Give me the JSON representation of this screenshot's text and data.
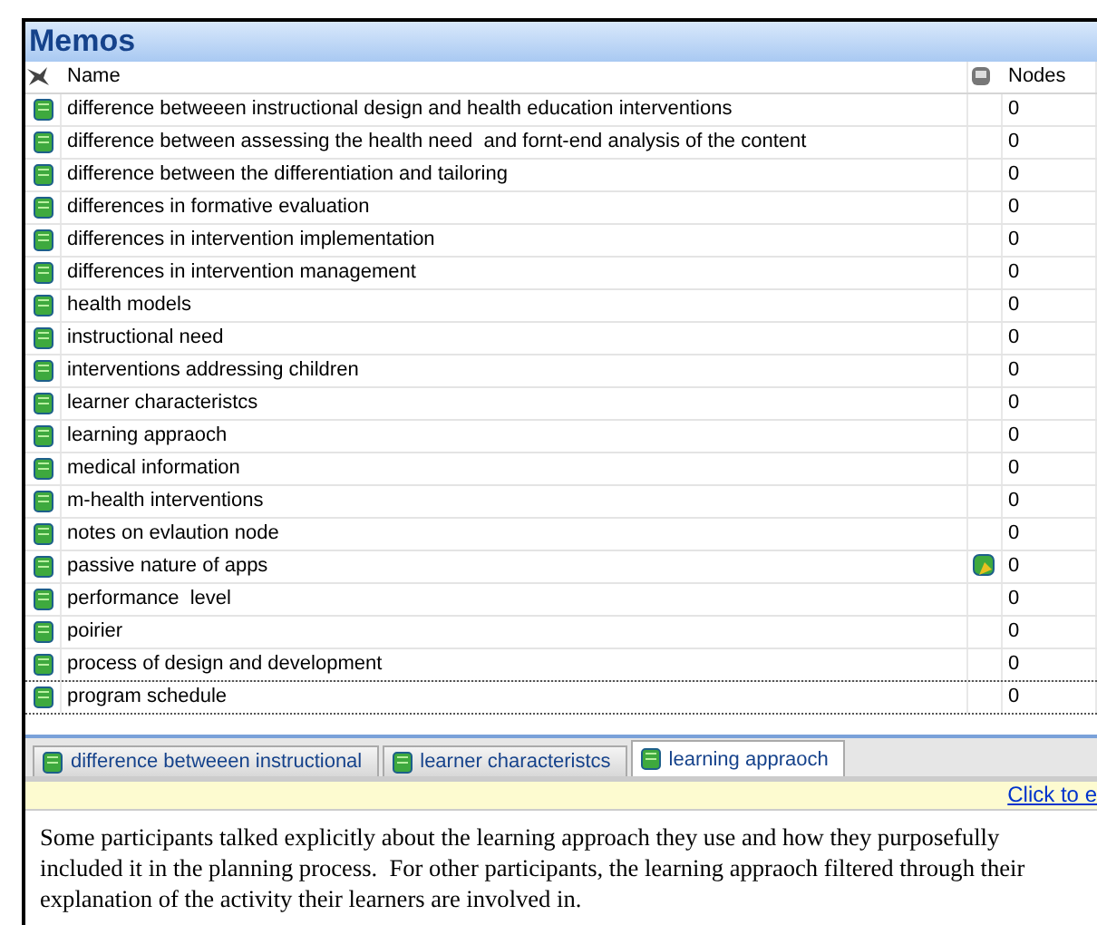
{
  "panel": {
    "title": "Memos"
  },
  "columns": [
    {
      "label": "Name"
    },
    {
      "label": "Nodes"
    }
  ],
  "rows": [
    {
      "name": "difference betweeen instructional design and health education interventions",
      "linked": false,
      "nodes": "0",
      "selected": false
    },
    {
      "name": "difference between assessing the health need  and fornt-end analysis of the content",
      "linked": false,
      "nodes": "0",
      "selected": false
    },
    {
      "name": "difference between the differentiation and tailoring",
      "linked": false,
      "nodes": "0",
      "selected": false
    },
    {
      "name": "differences in formative evaluation",
      "linked": false,
      "nodes": "0",
      "selected": false
    },
    {
      "name": "differences in intervention implementation",
      "linked": false,
      "nodes": "0",
      "selected": false
    },
    {
      "name": "differences in intervention management",
      "linked": false,
      "nodes": "0",
      "selected": false
    },
    {
      "name": "health models",
      "linked": false,
      "nodes": "0",
      "selected": false
    },
    {
      "name": "instructional need",
      "linked": false,
      "nodes": "0",
      "selected": false
    },
    {
      "name": "interventions addressing children",
      "linked": false,
      "nodes": "0",
      "selected": false
    },
    {
      "name": "learner characteristcs",
      "linked": false,
      "nodes": "0",
      "selected": false
    },
    {
      "name": "learning appraoch",
      "linked": false,
      "nodes": "0",
      "selected": false
    },
    {
      "name": "medical information",
      "linked": false,
      "nodes": "0",
      "selected": false
    },
    {
      "name": "m-health interventions",
      "linked": false,
      "nodes": "0",
      "selected": false
    },
    {
      "name": "notes on evlaution node",
      "linked": false,
      "nodes": "0",
      "selected": false
    },
    {
      "name": "passive nature of apps",
      "linked": true,
      "nodes": "0",
      "selected": false
    },
    {
      "name": "performance  level",
      "linked": false,
      "nodes": "0",
      "selected": false
    },
    {
      "name": "poirier",
      "linked": false,
      "nodes": "0",
      "selected": false
    },
    {
      "name": "process of design and development",
      "linked": false,
      "nodes": "0",
      "selected": false
    },
    {
      "name": "program schedule",
      "linked": false,
      "nodes": "0",
      "selected": true
    }
  ],
  "tabs": [
    {
      "label": "difference betweeen instructional",
      "selected": false
    },
    {
      "label": "learner characteristcs",
      "selected": false
    },
    {
      "label": "learning appraoch",
      "selected": true
    }
  ],
  "edit_link": "Click to e",
  "memo_text": "Some participants talked explicitly about the learning approach they use and how they purposefully included it in the planning process.  For other participants, the learning appraoch filtered through their explanation of the activity their learners are involved in."
}
